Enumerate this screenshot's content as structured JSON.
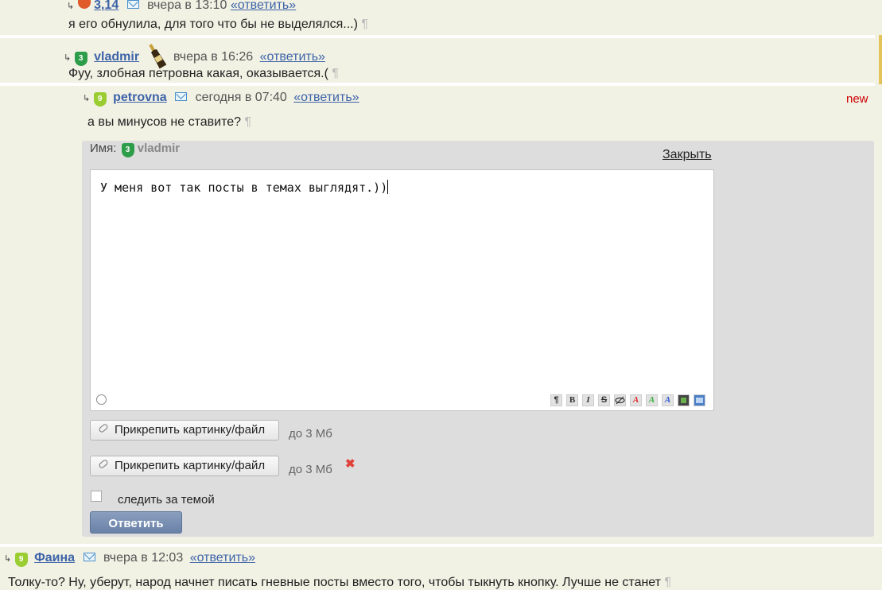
{
  "comments": [
    {
      "author": "3,14",
      "time": "вчера в 13:10",
      "reply_label": "«ответить»",
      "text": "я его обнулила, для того что бы не выделялся...)",
      "pilcrow": "¶"
    },
    {
      "author": "vladmir",
      "badge": "3",
      "time": "вчера в 16:26",
      "reply_label": "«ответить»",
      "text": "Фуу, злобная петровна какая, оказывается.(",
      "pilcrow": "¶"
    },
    {
      "author": "petrovna",
      "badge": "9",
      "time": "сегодня в 07:40",
      "reply_label": "«ответить»",
      "new_label": "new",
      "text": "а вы минусов не ставите?",
      "pilcrow": "¶"
    },
    {
      "author": "Фаина",
      "badge": "9",
      "time": "вчера в 12:03",
      "reply_label": "«ответить»",
      "text": "Толку-то? Ну, уберут, народ начнет писать гневные посты вместо того, чтобы тыкнуть кнопку. Лучше не станет",
      "pilcrow": "¶"
    }
  ],
  "reply_form": {
    "name_label": "Имя:",
    "name_value": "vladmir",
    "name_badge": "3",
    "close_label": "Закрыть",
    "textarea_value": "У меня вот так посты в темах выглядят.))",
    "toolbar": [
      "¶",
      "B",
      "I",
      "S",
      "spoiler",
      "A",
      "A",
      "A",
      "video",
      "image"
    ],
    "attach_label": "Прикрепить картинку/файл",
    "attach_limit": "до 3 Мб",
    "remove_icon": "✖",
    "follow_label": "следить за темой",
    "submit_label": "Ответить"
  },
  "colors": {
    "page_bg": "#f1f1e4",
    "form_bg": "#dddddd",
    "link": "#3d63a8",
    "new": "#cc0000",
    "badge_green": "#2d9d4a",
    "badge_lime": "#9acd32",
    "highlight_bar": "#e4c45a"
  }
}
